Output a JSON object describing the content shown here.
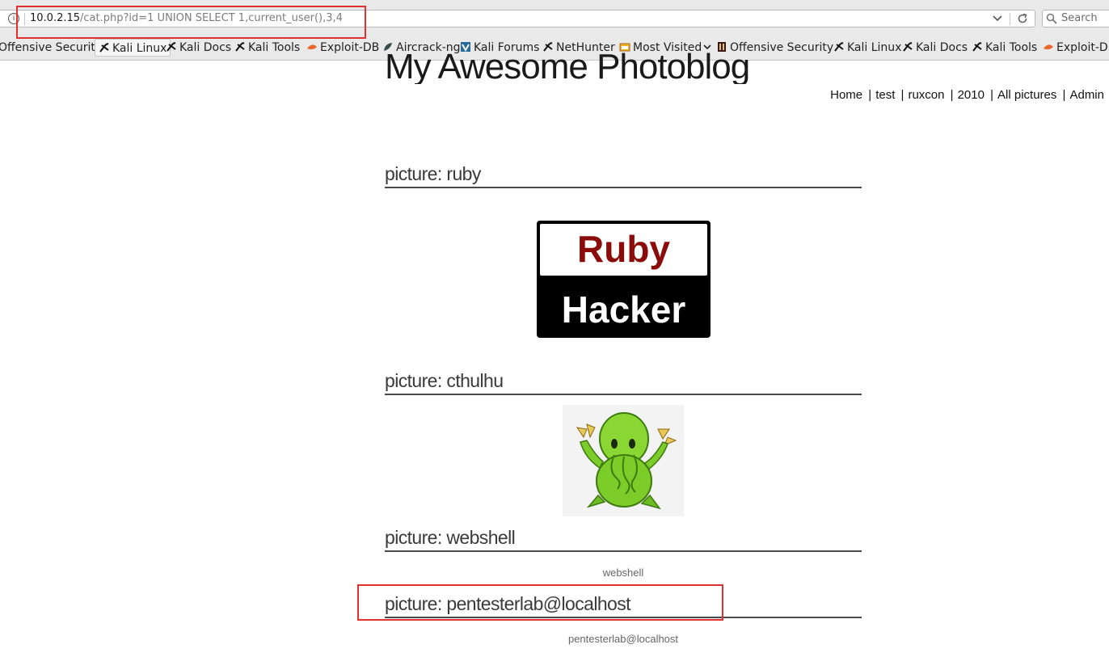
{
  "browser": {
    "url_host": "10.0.2.15",
    "url_path": "/cat.php?id=1 UNION SELECT 1,current_user(),3,4",
    "search_placeholder": "Search",
    "bookmarks": [
      {
        "label": "Offensive Security",
        "icon": "offsec-icon"
      },
      {
        "label": "Kali Linux",
        "icon": "kali-dragon-icon"
      },
      {
        "label": "Kali Docs",
        "icon": "kali-dragon-icon"
      },
      {
        "label": "Kali Tools",
        "icon": "kali-dragon-icon"
      },
      {
        "label": "Exploit-DB",
        "icon": "exploitdb-icon"
      },
      {
        "label": "Aircrack-ng",
        "icon": "aircrack-icon"
      },
      {
        "label": "Kali Forums",
        "icon": "kali-forums-icon"
      },
      {
        "label": "NetHunter",
        "icon": "kali-dragon-icon"
      },
      {
        "label": "Most Visited",
        "icon": "most-visited-folder-icon"
      },
      {
        "label": "Offensive Security",
        "icon": "offsec-icon"
      },
      {
        "label": "Kali Linux",
        "icon": "kali-dragon-icon"
      },
      {
        "label": "Kali Docs",
        "icon": "kali-dragon-icon"
      },
      {
        "label": "Kali Tools",
        "icon": "kali-dragon-icon"
      },
      {
        "label": "Exploit-DB",
        "icon": "exploitdb-icon"
      }
    ]
  },
  "page": {
    "site_title": "My Awesome Photoblog",
    "nav": [
      "Home",
      "test",
      "ruxcon",
      "2010",
      "All pictures",
      "Admin"
    ],
    "nav_separator": "|",
    "pictures": [
      {
        "heading": "picture: ruby",
        "image_line1": "Ruby",
        "image_line2": "Hacker"
      },
      {
        "heading": "picture: cthulhu"
      },
      {
        "heading": "picture: webshell",
        "caption": "webshell"
      },
      {
        "heading": "picture: pentesterlab@localhost",
        "caption": "pentesterlab@localhost"
      }
    ]
  },
  "colors": {
    "annotation": "#e03030",
    "ruby_red": "#8b0a0a"
  }
}
